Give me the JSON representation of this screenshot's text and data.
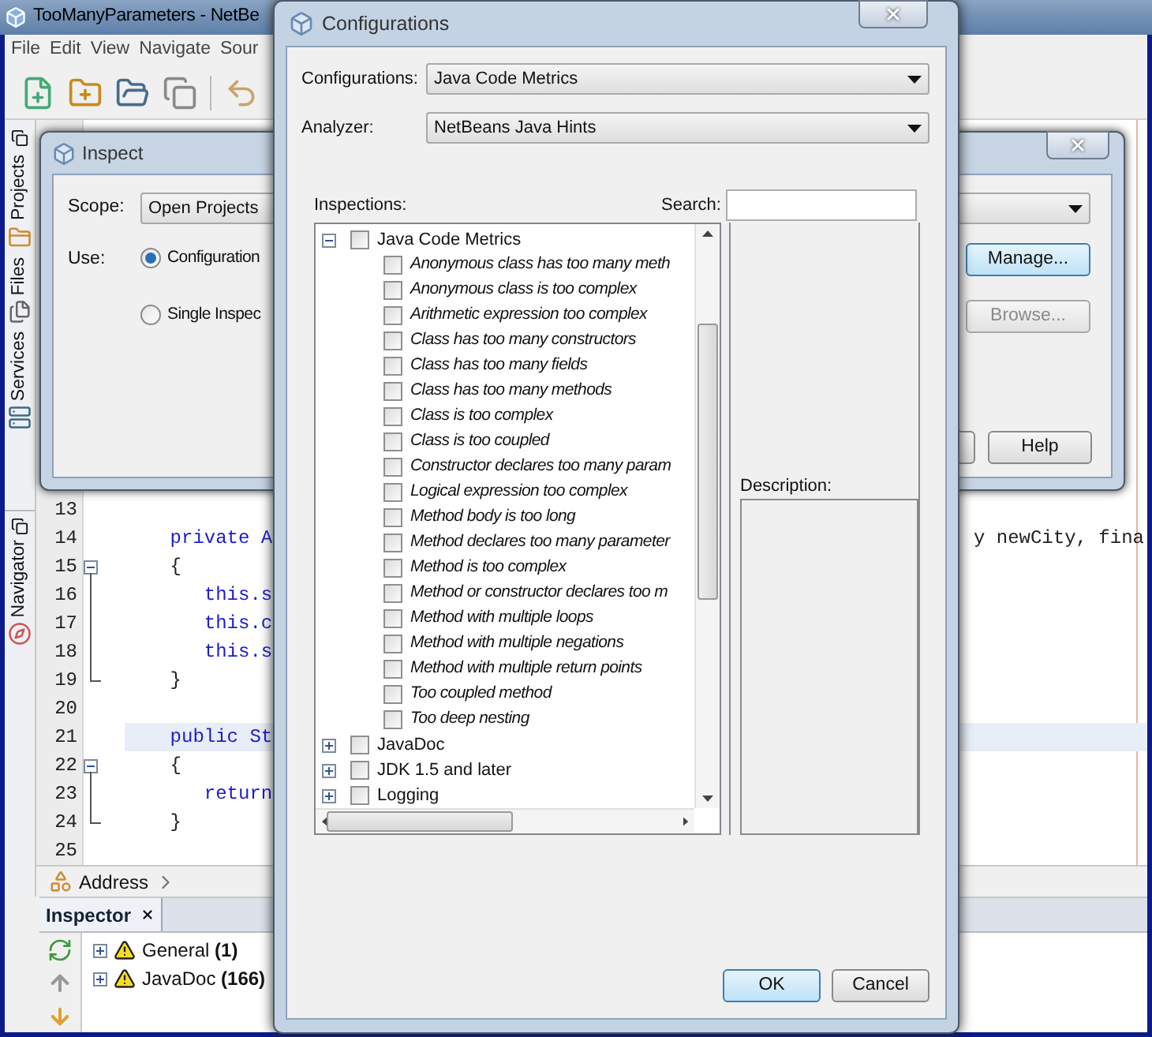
{
  "ide": {
    "title": "TooManyParameters - NetBe",
    "menu": [
      "File",
      "Edit",
      "View",
      "Navigate",
      "Sour"
    ],
    "side_tabs": [
      {
        "label": "Projects"
      },
      {
        "label": "Files"
      },
      {
        "label": "Services"
      }
    ],
    "navigator_tab": "Navigator",
    "code_lines": [
      {
        "number": "13",
        "fold_marker": false,
        "current": false
      },
      {
        "number": "14",
        "code": "    private A",
        "tail": "y newCity, fina",
        "kind": "code",
        "fold_marker": false,
        "current": false
      },
      {
        "number": "15",
        "code": "    {",
        "kind": "brace",
        "fold_marker": true,
        "current": false
      },
      {
        "number": "16",
        "code": "       this.s",
        "kind": "code",
        "fold_marker": false,
        "current": false
      },
      {
        "number": "17",
        "code": "       this.c",
        "kind": "code",
        "fold_marker": false,
        "current": false
      },
      {
        "number": "18",
        "code": "       this.s",
        "kind": "code",
        "fold_marker": false,
        "current": false
      },
      {
        "number": "19",
        "code": "    }",
        "kind": "brace",
        "fold_marker": false,
        "current": false
      },
      {
        "number": "20",
        "fold_marker": false,
        "current": false
      },
      {
        "number": "21",
        "code": "    public St",
        "kind": "code",
        "fold_marker": false,
        "current": true
      },
      {
        "number": "22",
        "code": "    {",
        "kind": "brace",
        "fold_marker": true,
        "current": false
      },
      {
        "number": "23",
        "code": "       return",
        "kind": "code",
        "fold_marker": false,
        "current": false
      },
      {
        "number": "24",
        "code": "    }",
        "kind": "brace",
        "fold_marker": false,
        "current": false
      },
      {
        "number": "25",
        "fold_marker": false,
        "current": false
      }
    ],
    "address": "Address",
    "inspector": {
      "tab": "Inspector",
      "items": [
        {
          "label": "General **(1)**",
          "expanded": false
        },
        {
          "label": "JavaDoc **(166)**",
          "expanded": false
        }
      ]
    }
  },
  "inspect_dialog": {
    "title": "Inspect",
    "scope_label": "Scope:",
    "scope_value": "Open Projects",
    "use_label": "Use:",
    "options": [
      {
        "label": "Configuration",
        "selected": true
      },
      {
        "label": "Single Inspec",
        "selected": false
      }
    ],
    "buttons": [
      {
        "label": "Manage...",
        "disabled": false,
        "focused": true
      },
      {
        "label": "Browse...",
        "disabled": true,
        "focused": false
      }
    ],
    "help_button": "Help"
  },
  "configurations_dialog": {
    "title": "Configurations",
    "configurations_label": "Configurations:",
    "configuration": "Java Code Metrics",
    "analyzer_label": "Analyzer:",
    "analyzer": "NetBeans Java Hints",
    "inspections_label": "Inspections:",
    "search_label": "Search:",
    "tree": [
      {
        "label": "Java Code Metrics",
        "checked": false,
        "expanded": true,
        "children": [
          {
            "label": "Anonymous class has too many meth",
            "checked": false
          },
          {
            "label": "Anonymous class is too complex",
            "checked": false
          },
          {
            "label": "Arithmetic expression too complex",
            "checked": false
          },
          {
            "label": "Class has too many constructors",
            "checked": false
          },
          {
            "label": "Class has too many fields",
            "checked": false
          },
          {
            "label": "Class has too many methods",
            "checked": false
          },
          {
            "label": "Class is too complex",
            "checked": false
          },
          {
            "label": "Class is too coupled",
            "checked": false
          },
          {
            "label": "Constructor declares too many param",
            "checked": false
          },
          {
            "label": "Logical expression too complex",
            "checked": false
          },
          {
            "label": "Method body is too long",
            "checked": false
          },
          {
            "label": "Method declares too many parameter",
            "checked": false
          },
          {
            "label": "Method is too complex",
            "checked": false
          },
          {
            "label": "Method or constructor declares too m",
            "checked": false
          },
          {
            "label": "Method with multiple loops",
            "checked": false
          },
          {
            "label": "Method with multiple negations",
            "checked": false
          },
          {
            "label": "Method with multiple return points",
            "checked": false
          },
          {
            "label": "Too coupled method",
            "checked": false
          },
          {
            "label": "Too deep nesting",
            "checked": false
          }
        ]
      },
      {
        "label": "JavaDoc",
        "checked": false,
        "expanded": false
      },
      {
        "label": "JDK 1.5 and later",
        "checked": false,
        "expanded": false
      },
      {
        "label": "Logging",
        "checked": false,
        "expanded": false
      }
    ],
    "description_label": "Description:",
    "buttons": [
      {
        "label": "OK",
        "focused": true
      },
      {
        "label": "Cancel",
        "focused": false
      }
    ]
  }
}
